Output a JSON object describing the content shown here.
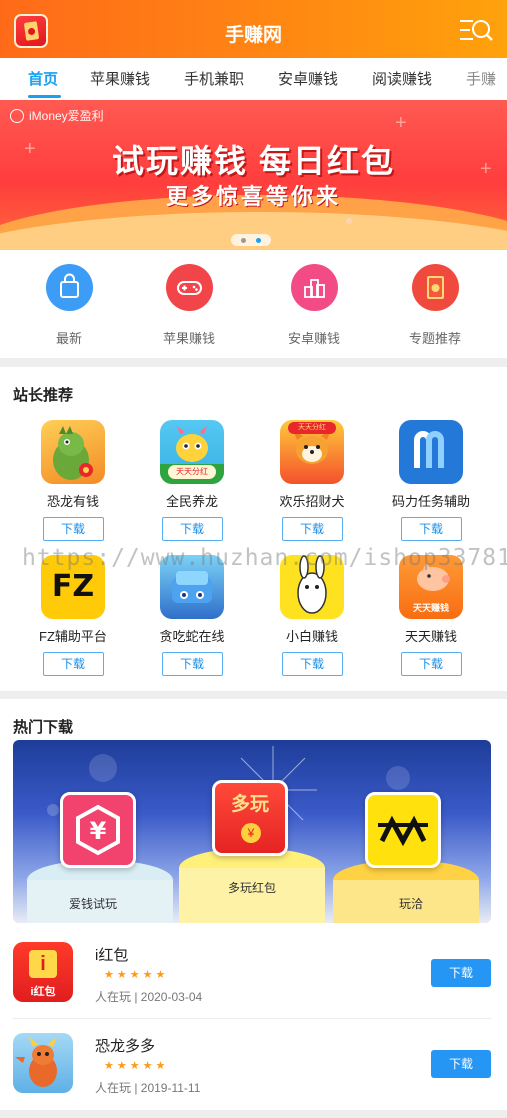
{
  "header": {
    "title": "手赚网"
  },
  "tabs": [
    {
      "label": "首页",
      "active": true
    },
    {
      "label": "苹果赚钱"
    },
    {
      "label": "手机兼职"
    },
    {
      "label": "安卓赚钱"
    },
    {
      "label": "阅读赚钱"
    },
    {
      "label": "手赚"
    }
  ],
  "banner": {
    "brand": "iMoney爱盈利",
    "headline": "试玩赚钱 每日红包",
    "subline": "更多惊喜等你来",
    "slides": 2,
    "active_slide": 2
  },
  "categories": [
    {
      "label": "最新",
      "icon": "shopping-bag-icon",
      "color": "#3d9cf5"
    },
    {
      "label": "苹果赚钱",
      "icon": "gamepad-icon",
      "color": "#f2454a"
    },
    {
      "label": "安卓赚钱",
      "icon": "podium-icon",
      "color": "#f24b85"
    },
    {
      "label": "专题推荐",
      "icon": "red-envelope-icon",
      "color": "#f04a3e"
    }
  ],
  "recommend": {
    "title": "站长推荐",
    "download_label": "下载",
    "apps": [
      {
        "name": "恐龙有钱",
        "icon": "dinosaur-icon"
      },
      {
        "name": "全民养龙",
        "icon": "dragon-icon",
        "badge": "天天分红"
      },
      {
        "name": "欢乐招财犬",
        "icon": "dog-icon",
        "badge": "天天分红"
      },
      {
        "name": "码力任务辅助",
        "icon": "m-logo-icon"
      },
      {
        "name": "FZ辅助平台",
        "icon": "fz-logo-icon",
        "logo_text": "FZ"
      },
      {
        "name": "贪吃蛇在线",
        "icon": "snake-game-icon"
      },
      {
        "name": "小白赚钱",
        "icon": "rabbit-icon"
      },
      {
        "name": "天天赚钱",
        "icon": "piggy-bank-icon",
        "badge": "天天赚钱"
      }
    ]
  },
  "watermark": "https://www.huzhan.com/ishop33781",
  "hot": {
    "title": "热门下载",
    "featured": [
      {
        "label": "爱钱试玩",
        "icon": "yen-hexagon-icon"
      },
      {
        "label": "多玩红包",
        "icon": "duowan-envelope-icon",
        "logo_text": "多玩"
      },
      {
        "label": "玩洽",
        "icon": "wanqia-logo-icon"
      }
    ],
    "list": [
      {
        "name": "i红包",
        "icon": "i-envelope-icon",
        "logo_text": "i红包",
        "rating": 5,
        "stars": "★★★★★",
        "meta": "人在玩 | 2020-03-04",
        "button": "下载"
      },
      {
        "name": "恐龙多多",
        "icon": "dragon-red-icon",
        "rating": 5,
        "stars": "★★★★★",
        "meta": "人在玩 | 2019-11-11",
        "button": "下载"
      }
    ]
  }
}
